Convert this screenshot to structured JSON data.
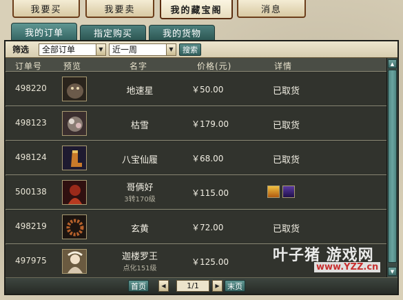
{
  "top_tabs": [
    {
      "label": "我要买",
      "active": false
    },
    {
      "label": "我要卖",
      "active": false
    },
    {
      "label": "我的藏宝阁",
      "active": true
    },
    {
      "label": "消息",
      "active": false
    }
  ],
  "sub_tabs": [
    {
      "label": "我的订单",
      "active": true
    },
    {
      "label": "指定购买",
      "active": false
    },
    {
      "label": "我的货物",
      "active": false
    }
  ],
  "filter": {
    "label": "筛选",
    "order_type": "全部订单",
    "time_range": "近一周",
    "search_label": "搜索"
  },
  "table": {
    "headers": {
      "id": "订单号",
      "preview": "预览",
      "name": "名字",
      "price": "价格(元)",
      "detail": "详情"
    },
    "rows": [
      {
        "id": "498220",
        "name": "地速星",
        "sub": "",
        "price": "￥50.00",
        "detail": "已取货",
        "thumb_color": "#6b5a4a"
      },
      {
        "id": "498123",
        "name": "枯雪",
        "sub": "",
        "price": "￥179.00",
        "detail": "已取货",
        "thumb_color": "#8a7d74"
      },
      {
        "id": "498124",
        "name": "八宝仙履",
        "sub": "",
        "price": "￥68.00",
        "detail": "已取货",
        "thumb_color": "#c97a2a"
      },
      {
        "id": "500138",
        "name": "哥俩好",
        "sub": "3转170级",
        "price": "￥115.00",
        "detail": "",
        "thumb_color": "#9a2a1a",
        "detail_icons": [
          "treasure-chest-icon",
          "pet-icon"
        ]
      },
      {
        "id": "498219",
        "name": "玄黄",
        "sub": "",
        "price": "￥72.00",
        "detail": "已取货",
        "thumb_color": "#7a3a1c"
      },
      {
        "id": "497975",
        "name": "迦楼罗王",
        "sub": "点化151级",
        "price": "￥125.00",
        "detail": "",
        "thumb_color": "#d8c8b0"
      }
    ]
  },
  "pagination": {
    "first_label": "首页",
    "page_display": "1/1",
    "last_label": "末页"
  },
  "watermark": {
    "main": "叶子猪 游戏网",
    "url": "www.YZZ.cn"
  }
}
